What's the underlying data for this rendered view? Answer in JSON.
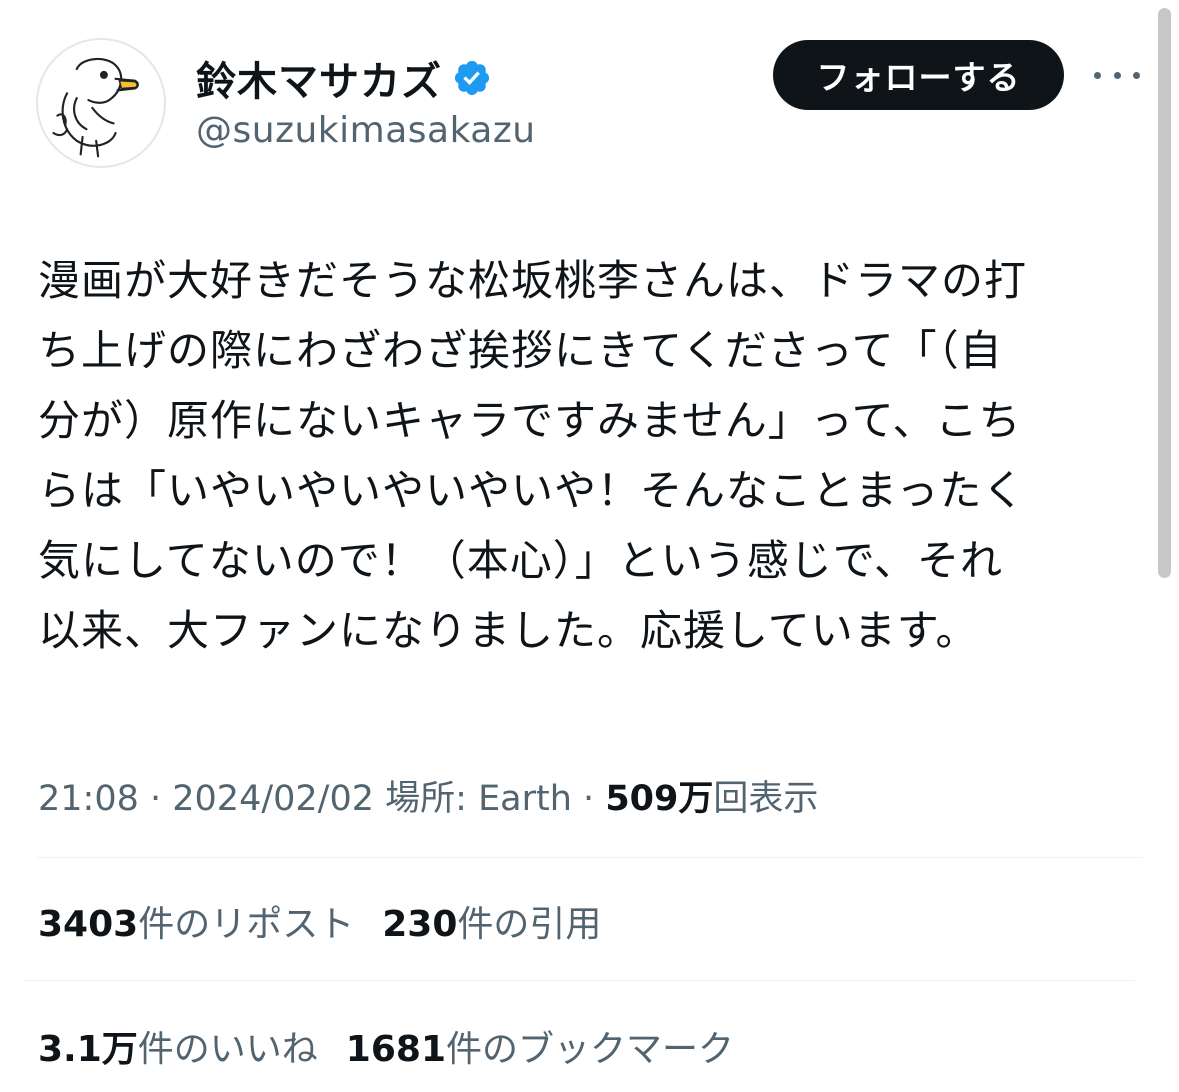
{
  "user": {
    "display_name": "鈴木マサカズ",
    "handle": "@suzukimasakazu",
    "verified_icon": "verified-badge-icon",
    "verified_color": "#1d9bf0",
    "avatar_icon": "duck-drawing-avatar"
  },
  "actions": {
    "follow_label": "フォローする",
    "more_icon": "more-options-icon"
  },
  "tweet": {
    "text": "漫画が大好きだそうな松坂桃李さんは、ドラマの打\nち上げの際にわざわざ挨拶にきてくださって「（自\n分が）原作にないキャラですみません」って、こち\nらは「いやいやいやいやいや！そんなことまったく\n気にしてないので！（本心）」という感じで、それ\n以来、大ファンになりました。応援しています。"
  },
  "meta": {
    "time": "21:08",
    "separator": " · ",
    "date": "2024/02/02",
    "location_label": "場所: ",
    "location": "Earth",
    "views_count": "509万",
    "views_label": "回表示"
  },
  "stats": {
    "reposts_count": "3403",
    "reposts_label": "件のリポスト",
    "quotes_count": "230",
    "quotes_label": "件の引用",
    "likes_count": "3.1万",
    "likes_label": "件のいいね",
    "bookmarks_count": "1681",
    "bookmarks_label": "件のブックマーク"
  },
  "colors": {
    "text_primary": "#0f1419",
    "text_secondary": "#536471",
    "divider": "#eff3f4",
    "button_bg": "#0f1419"
  }
}
